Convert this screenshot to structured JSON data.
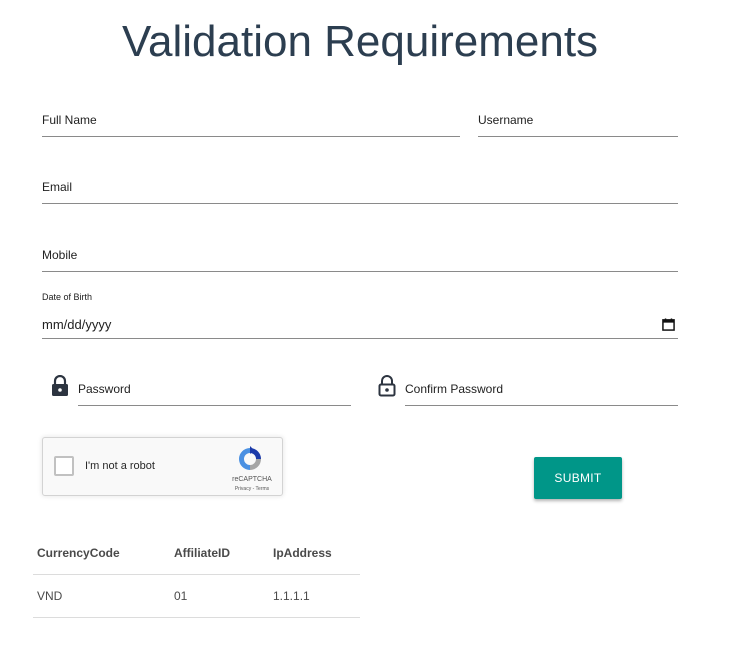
{
  "page": {
    "title": "Validation Requirements"
  },
  "form": {
    "full_name": {
      "label": "Full Name",
      "value": ""
    },
    "username": {
      "label": "Username",
      "value": ""
    },
    "email": {
      "label": "Email",
      "value": ""
    },
    "mobile": {
      "label": "Mobile",
      "value": ""
    },
    "date_of_birth": {
      "label": "Date of Birth",
      "placeholder": "mm/dd/yyyy",
      "icon": "calendar-icon"
    },
    "password": {
      "label": "Password",
      "value": "",
      "icon": "lock-icon"
    },
    "confirm_password": {
      "label": "Confirm Password",
      "value": "",
      "icon": "lock-open-icon"
    },
    "submit_label": "SUBMIT"
  },
  "captcha": {
    "label": "I'm not a robot",
    "checked": false,
    "brand": "reCAPTCHA",
    "links": "Privacy - Terms"
  },
  "table": {
    "headers": [
      "CurrencyCode",
      "AffiliateID",
      "IpAddress"
    ],
    "rows": [
      [
        "VND",
        "01",
        "1.1.1.1"
      ]
    ]
  },
  "colors": {
    "accent": "#009688",
    "title": "#2c3e50"
  }
}
